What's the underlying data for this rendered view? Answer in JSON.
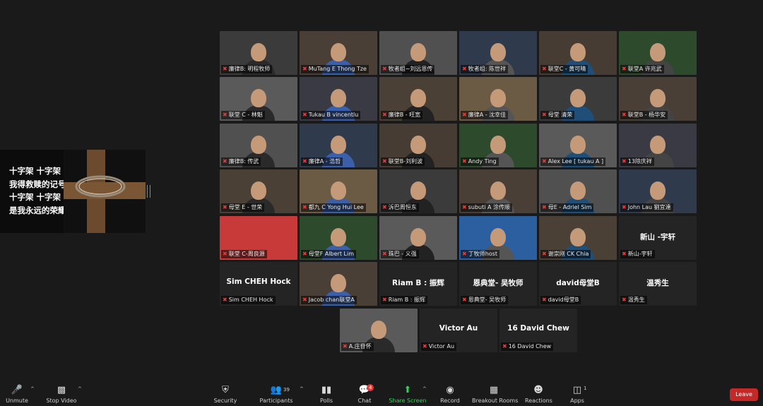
{
  "share_screen": {
    "lyrics": [
      "十字架 十字架",
      "我得救赎的记号",
      "十字架 十字架",
      "是我永远的荣耀"
    ]
  },
  "tiles": [
    {
      "name": "廉律B: 明程牧师",
      "big": ""
    },
    {
      "name": "MuTang E Thong Tze",
      "big": ""
    },
    {
      "name": "牧者组~刘远恩传",
      "big": ""
    },
    {
      "name": "牧者组: 陈世祥",
      "big": ""
    },
    {
      "name": "联堂C - 黄可晴",
      "big": ""
    },
    {
      "name": "联堂A 许兆武",
      "big": ""
    },
    {
      "name": "联堂 C - 林魁",
      "big": ""
    },
    {
      "name": "Tukau B vincentlu",
      "big": ""
    },
    {
      "name": "廉律B - 旺宽",
      "big": ""
    },
    {
      "name": "廉律A - 沈幸佳",
      "big": ""
    },
    {
      "name": "母堂 清荣",
      "big": ""
    },
    {
      "name": "联堂B - 杨华安",
      "big": ""
    },
    {
      "name": "廉律B: 传武",
      "big": ""
    },
    {
      "name": "廉律A - 浩哲",
      "big": ""
    },
    {
      "name": "联堂B-刘利波",
      "big": ""
    },
    {
      "name": "Andy Ting",
      "big": ""
    },
    {
      "name": "Alex Lee [ tukau A ]",
      "big": ""
    },
    {
      "name": "13除庆祥",
      "big": ""
    },
    {
      "name": "母堂 E - 世荣",
      "big": ""
    },
    {
      "name": "都九 C Yong Hui Lee",
      "big": ""
    },
    {
      "name": "泝巴周恒东",
      "big": ""
    },
    {
      "name": "subuti A 涂传顺",
      "big": ""
    },
    {
      "name": "母E - Adriel Sim",
      "big": ""
    },
    {
      "name": "John Lau 劉宜達",
      "big": ""
    },
    {
      "name": "联堂 C-周良源",
      "big": ""
    },
    {
      "name": "母堂F Albert Lim",
      "big": ""
    },
    {
      "name": "珠巴 - 义强",
      "big": ""
    },
    {
      "name": "丁牧师host",
      "big": ""
    },
    {
      "name": "谢崇刚 CK Chia",
      "big": ""
    },
    {
      "name": "新山-宇轩",
      "big": "新山 -宇轩"
    },
    {
      "name": "Sim CHEH Hock",
      "big": "Sim CHEH Hock"
    },
    {
      "name": "Jacob chan联堂A",
      "big": ""
    },
    {
      "name": "Riam B : 振辉",
      "big": "Riam B : 振辉"
    },
    {
      "name": "恩典堂- 吴牧师",
      "big": "恩典堂- 吴牧师"
    },
    {
      "name": "david母堂B",
      "big": "david母堂B"
    },
    {
      "name": "温秀生",
      "big": "温秀生"
    },
    {
      "name": "A.庄苷怀",
      "big": ""
    },
    {
      "name": "Victor Au",
      "big": "Victor Au"
    },
    {
      "name": "16 David Chew",
      "big": "16 David Chew"
    }
  ],
  "toolbar": {
    "unmute": "Unmute",
    "stop_video": "Stop Video",
    "security": "Security",
    "participants": "Participants",
    "participants_count": "39",
    "polls": "Polls",
    "chat": "Chat",
    "chat_badge": "4",
    "share_screen": "Share Screen",
    "record": "Record",
    "breakout_rooms": "Breakout Rooms",
    "reactions": "Reactions",
    "apps": "Apps",
    "apps_count": "1",
    "leave": "Leave"
  },
  "colors": {
    "active_speaker_border": "#d9cf59",
    "share_green": "#2fd35a",
    "leave_red": "#c62828",
    "mic_off_red": "#e23b3b"
  }
}
